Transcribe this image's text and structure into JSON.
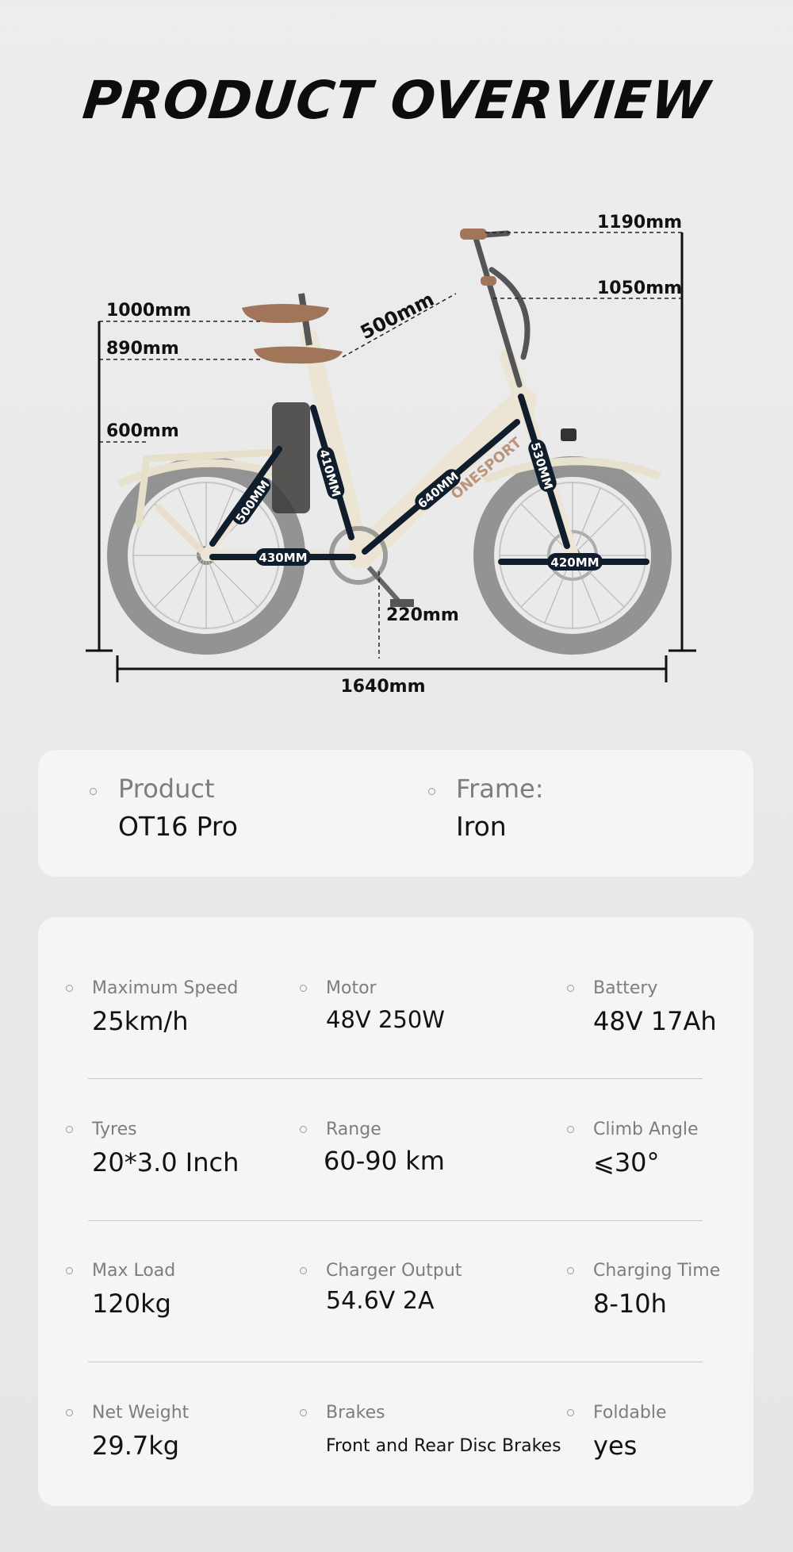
{
  "title": "PRODUCT OVERVIEW",
  "dimensions": {
    "seat_high": "1000mm",
    "seat_low": "890mm",
    "rack_height": "600mm",
    "handlebar_high": "1190mm",
    "handlebar_low": "1050mm",
    "seat_to_handlebar": "500mm",
    "length": "1640mm",
    "ground_clearance": "220mm",
    "seat_stay": "500MM",
    "seat_tube": "410MM",
    "chain_stay": "430MM",
    "down_tube": "640MM",
    "fork": "530MM",
    "wheel": "420MM",
    "frame_brand": "ONESPORT"
  },
  "overview": [
    {
      "label": "Product",
      "value": "OT16 Pro"
    },
    {
      "label": "Frame:",
      "value": "Iron"
    }
  ],
  "specs": [
    {
      "label": "Maximum Speed",
      "value": "25km/h"
    },
    {
      "label": "Motor",
      "value": "48V 250W"
    },
    {
      "label": "Battery",
      "value": "48V 17Ah"
    },
    {
      "label": "Tyres",
      "value": "20*3.0 Inch"
    },
    {
      "label": "Range",
      "value": "60-90 km"
    },
    {
      "label": "Climb Angle",
      "value": "⩽30°"
    },
    {
      "label": "Max Load",
      "value": "120kg"
    },
    {
      "label": "Charger Output",
      "value": "54.6V 2A"
    },
    {
      "label": "Charging Time",
      "value": "8-10h"
    },
    {
      "label": "Net Weight",
      "value": "29.7kg"
    },
    {
      "label": "Brakes",
      "value": "Front and Rear Disc Brakes"
    },
    {
      "label": "Foldable",
      "value": "yes"
    }
  ],
  "colors": {
    "frame_cream": "#efe9dc",
    "tire_gray": "#6e6e6e",
    "marker_navy": "#0f1d2c",
    "saddle_brown": "#a0755a"
  }
}
